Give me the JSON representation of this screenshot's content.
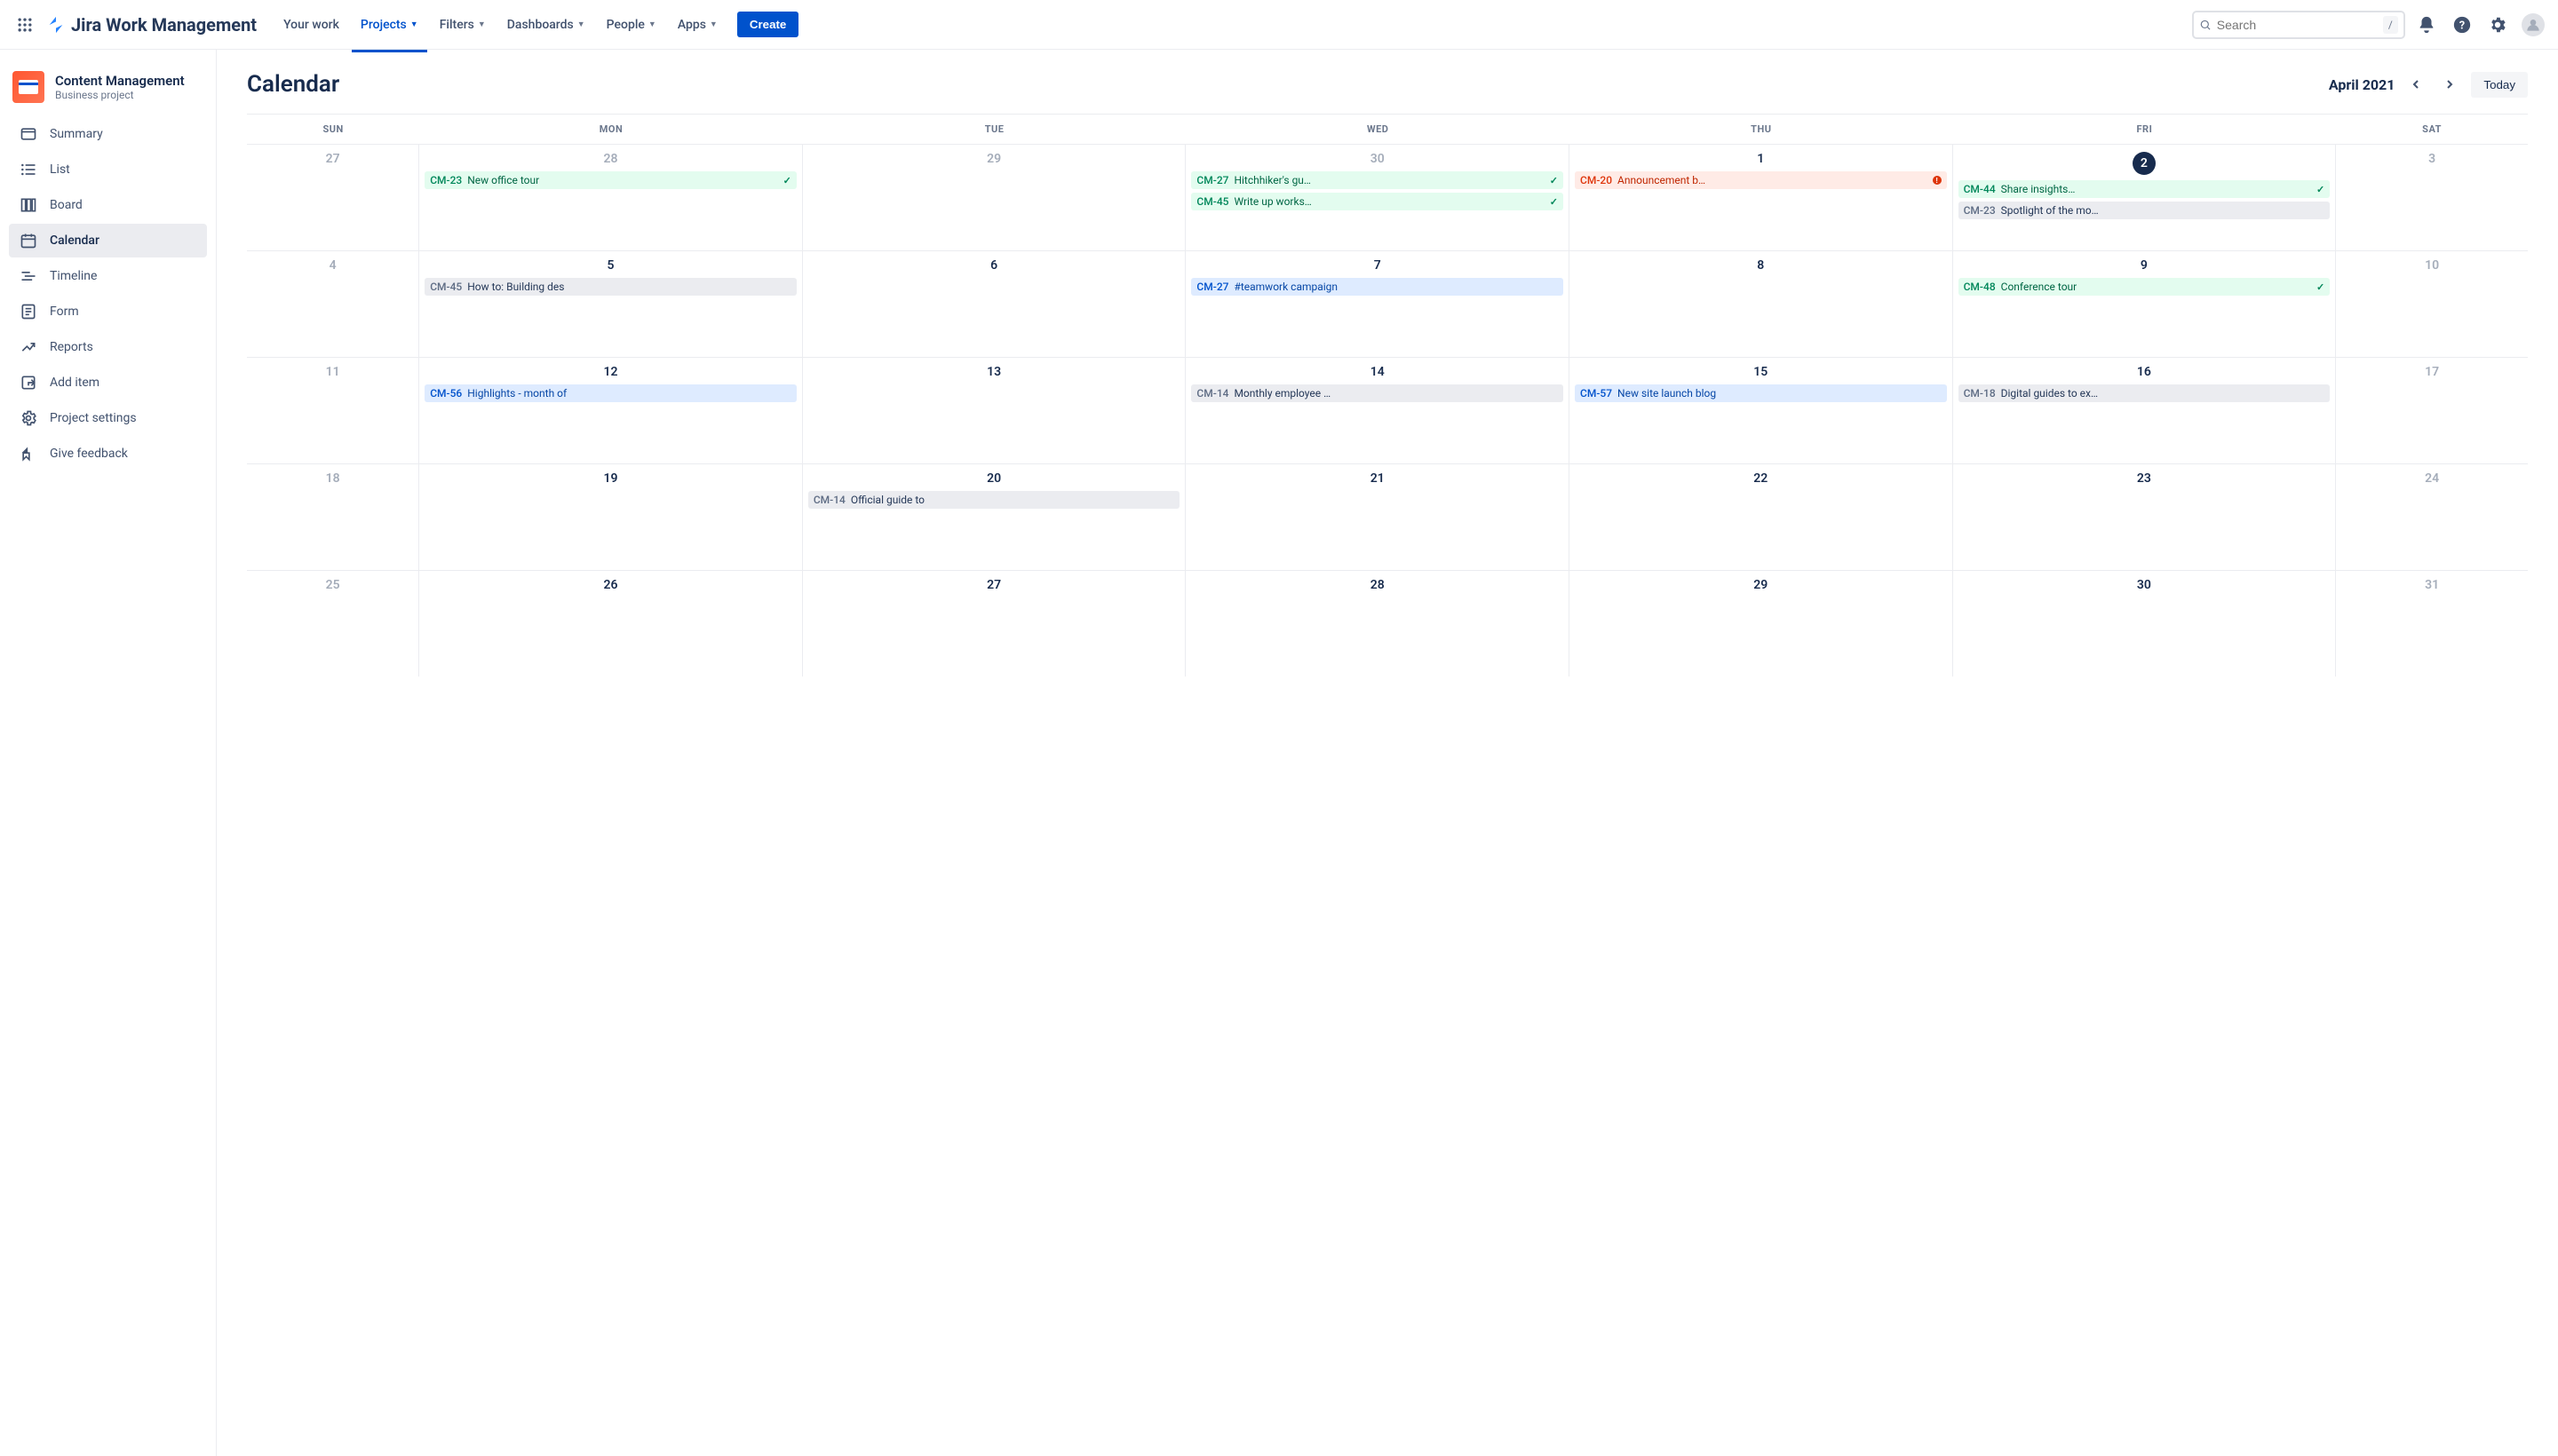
{
  "topnav": {
    "product": "Jira Work Management",
    "items": [
      {
        "label": "Your work",
        "dropdown": false,
        "active": false
      },
      {
        "label": "Projects",
        "dropdown": true,
        "active": true
      },
      {
        "label": "Filters",
        "dropdown": true,
        "active": false
      },
      {
        "label": "Dashboards",
        "dropdown": true,
        "active": false
      },
      {
        "label": "People",
        "dropdown": true,
        "active": false
      },
      {
        "label": "Apps",
        "dropdown": true,
        "active": false
      }
    ],
    "create": "Create",
    "search_placeholder": "Search",
    "slash": "/"
  },
  "sidebar": {
    "project_name": "Content Management",
    "project_type": "Business project",
    "items": [
      {
        "label": "Summary",
        "icon": "summary"
      },
      {
        "label": "List",
        "icon": "list"
      },
      {
        "label": "Board",
        "icon": "board"
      },
      {
        "label": "Calendar",
        "icon": "calendar",
        "selected": true
      },
      {
        "label": "Timeline",
        "icon": "timeline"
      },
      {
        "label": "Form",
        "icon": "form"
      },
      {
        "label": "Reports",
        "icon": "reports"
      },
      {
        "label": "Add item",
        "icon": "add"
      },
      {
        "label": "Project settings",
        "icon": "settings"
      },
      {
        "label": "Give feedback",
        "icon": "feedback"
      }
    ]
  },
  "main": {
    "title": "Calendar",
    "month_label": "April 2021",
    "today_label": "Today",
    "days_of_week": [
      "SUN",
      "MON",
      "TUE",
      "WED",
      "THU",
      "FRI",
      "SAT"
    ],
    "weeks": [
      {
        "days": [
          {
            "num": "27",
            "dim": true
          },
          {
            "num": "28",
            "dim": true,
            "events": [
              {
                "key": "CM-23",
                "title": "New office tour",
                "color": "green",
                "done": true
              }
            ]
          },
          {
            "num": "29",
            "dim": true
          },
          {
            "num": "30",
            "dim": true,
            "events": [
              {
                "key": "CM-27",
                "title": "Hitchhiker's gu…",
                "color": "green",
                "done": true
              },
              {
                "key": "CM-45",
                "title": "Write up works…",
                "color": "green",
                "done": true
              }
            ]
          },
          {
            "num": "1",
            "events": [
              {
                "key": "CM-20",
                "title": "Announcement b…",
                "color": "red",
                "alert": true
              }
            ]
          },
          {
            "num": "2",
            "today": true,
            "events": [
              {
                "key": "CM-44",
                "title": "Share insights…",
                "color": "green",
                "done": true
              },
              {
                "key": "CM-23",
                "title": "Spotlight of the mo…",
                "color": "gray"
              }
            ]
          },
          {
            "num": "3",
            "dim": true
          }
        ]
      },
      {
        "days": [
          {
            "num": "4",
            "dim": true
          },
          {
            "num": "5",
            "events": [
              {
                "key": "CM-45",
                "title": "How to: Building des",
                "color": "gray"
              }
            ]
          },
          {
            "num": "6"
          },
          {
            "num": "7",
            "events": [
              {
                "key": "CM-27",
                "title": "#teamwork campaign",
                "color": "blue"
              }
            ]
          },
          {
            "num": "8"
          },
          {
            "num": "9",
            "events": [
              {
                "key": "CM-48",
                "title": "Conference tour",
                "color": "green",
                "done": true
              }
            ]
          },
          {
            "num": "10",
            "dim": true
          }
        ]
      },
      {
        "days": [
          {
            "num": "11",
            "dim": true
          },
          {
            "num": "12",
            "events": [
              {
                "key": "CM-56",
                "title": "Highlights - month of",
                "color": "blue"
              }
            ]
          },
          {
            "num": "13"
          },
          {
            "num": "14",
            "events": [
              {
                "key": "CM-14",
                "title": "Monthly employee …",
                "color": "gray"
              }
            ]
          },
          {
            "num": "15",
            "events": [
              {
                "key": "CM-57",
                "title": "New site launch blog",
                "color": "blue"
              }
            ]
          },
          {
            "num": "16",
            "events": [
              {
                "key": "CM-18",
                "title": "Digital guides to ex…",
                "color": "gray"
              }
            ]
          },
          {
            "num": "17",
            "dim": true
          }
        ]
      },
      {
        "days": [
          {
            "num": "18",
            "dim": true
          },
          {
            "num": "19"
          },
          {
            "num": "20",
            "events": [
              {
                "key": "CM-14",
                "title": "Official guide to",
                "color": "gray"
              }
            ]
          },
          {
            "num": "21"
          },
          {
            "num": "22"
          },
          {
            "num": "23"
          },
          {
            "num": "24",
            "dim": true
          }
        ]
      },
      {
        "days": [
          {
            "num": "25",
            "dim": true
          },
          {
            "num": "26"
          },
          {
            "num": "27"
          },
          {
            "num": "28"
          },
          {
            "num": "29"
          },
          {
            "num": "30"
          },
          {
            "num": "31",
            "dim": true
          }
        ]
      }
    ]
  }
}
